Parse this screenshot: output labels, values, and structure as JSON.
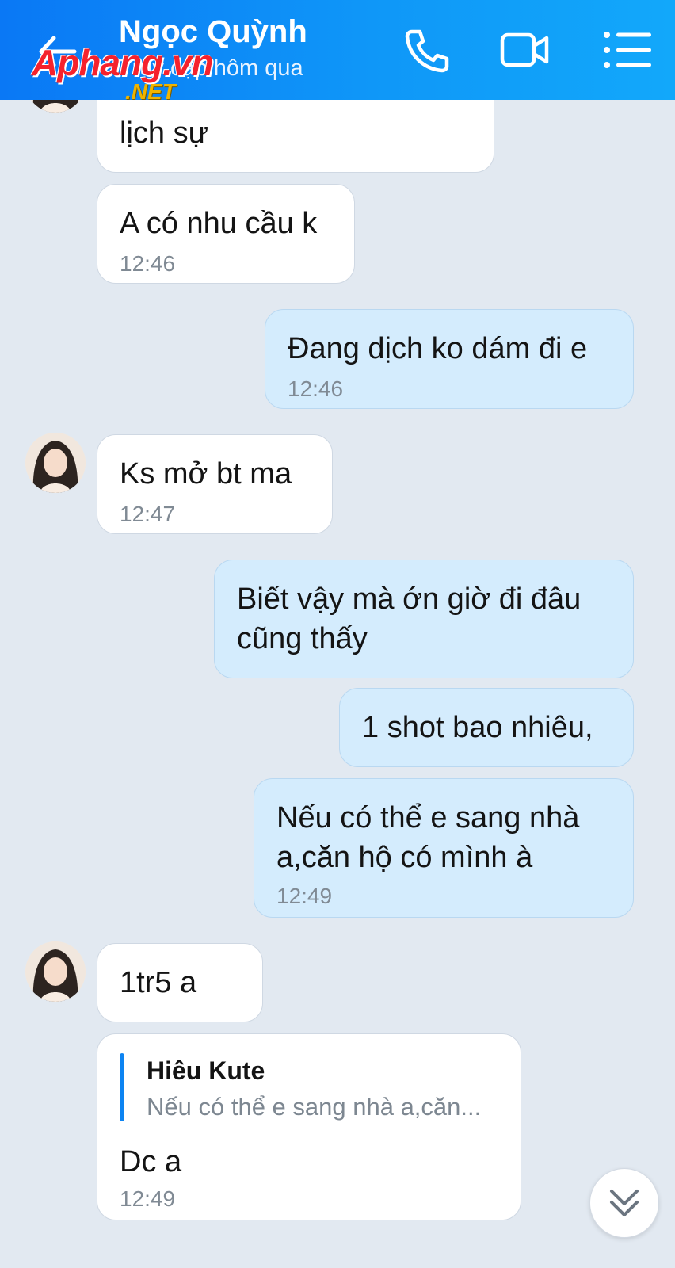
{
  "header": {
    "title": "Ngọc Quỳnh",
    "subtitle": "Truy cập hôm qua"
  },
  "watermark": {
    "main": "Aphang.vn",
    "sub": ".NET"
  },
  "messages": [
    {
      "direction": "in",
      "text": "Luôn tiền nhận trao đổi lịch sự",
      "visible_text": "lịch sự",
      "time": ""
    },
    {
      "direction": "in",
      "text": "A có nhu cầu k",
      "time": "12:46"
    },
    {
      "direction": "out",
      "text": "Đang dịch ko dám đi e",
      "time": "12:46"
    },
    {
      "direction": "in",
      "text": "Ks mở bt ma",
      "time": "12:47"
    },
    {
      "direction": "out",
      "text": "Biết vậy mà ớn giờ đi đâu cũng thấy",
      "time": ""
    },
    {
      "direction": "out",
      "text": "1 shot bao nhiêu,",
      "time": ""
    },
    {
      "direction": "out",
      "text": "Nếu có thể e sang nhà a,căn hộ có mình à",
      "time": "12:49"
    },
    {
      "direction": "in",
      "text": "1tr5 a",
      "time": ""
    },
    {
      "direction": "in",
      "quote": {
        "name": "Hiêu Kute",
        "text": "Nếu có thể e sang nhà a,căn..."
      },
      "text": "Dc a",
      "time": "12:49"
    }
  ],
  "colors": {
    "header_gradient_start": "#0a78f5",
    "header_gradient_end": "#12a8fa",
    "background": "#e2e9f1",
    "incoming_bubble": "#ffffff",
    "outgoing_bubble": "#d4ecfd",
    "quote_accent": "#0d84f2",
    "watermark_red": "#f5222d",
    "watermark_gold": "#f0b400"
  },
  "icons": {
    "back": "arrow-left-icon",
    "call": "phone-icon",
    "video": "video-camera-icon",
    "menu": "menu-list-icon",
    "scroll": "double-chevron-down-icon"
  }
}
